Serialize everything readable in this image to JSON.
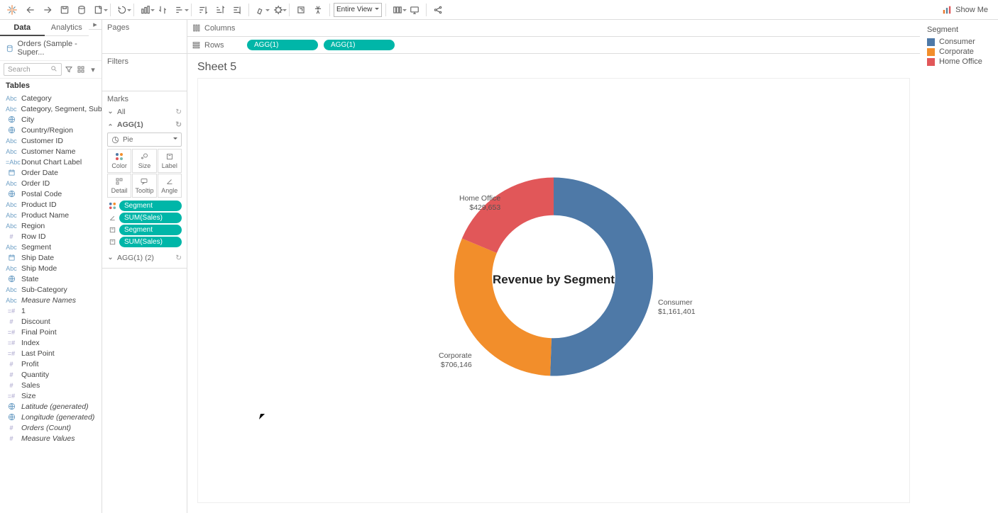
{
  "toolbar": {
    "fit_mode": "Entire View",
    "showme_label": "Show Me"
  },
  "side_tabs": {
    "data": "Data",
    "analytics": "Analytics"
  },
  "datasource": {
    "label": "Orders (Sample - Super..."
  },
  "search": {
    "placeholder": "Search"
  },
  "tables_header": "Tables",
  "fields": [
    {
      "t": "Abc",
      "n": "Category"
    },
    {
      "t": "Abc",
      "n": "Category, Segment, Sub-..."
    },
    {
      "t": "globe",
      "n": "City"
    },
    {
      "t": "globe",
      "n": "Country/Region"
    },
    {
      "t": "Abc",
      "n": "Customer ID"
    },
    {
      "t": "Abc",
      "n": "Customer Name"
    },
    {
      "t": "=Abc",
      "n": "Donut Chart Label"
    },
    {
      "t": "date",
      "n": "Order Date"
    },
    {
      "t": "Abc",
      "n": "Order ID"
    },
    {
      "t": "globe",
      "n": "Postal Code"
    },
    {
      "t": "Abc",
      "n": "Product ID"
    },
    {
      "t": "Abc",
      "n": "Product Name"
    },
    {
      "t": "Abc",
      "n": "Region"
    },
    {
      "t": "#",
      "n": "Row ID"
    },
    {
      "t": "Abc",
      "n": "Segment"
    },
    {
      "t": "date",
      "n": "Ship Date"
    },
    {
      "t": "Abc",
      "n": "Ship Mode"
    },
    {
      "t": "globe",
      "n": "State"
    },
    {
      "t": "Abc",
      "n": "Sub-Category"
    },
    {
      "t": "Abc",
      "n": "Measure Names",
      "i": true
    },
    {
      "t": "=#",
      "n": "1"
    },
    {
      "t": "#",
      "n": "Discount"
    },
    {
      "t": "=#",
      "n": "Final Point"
    },
    {
      "t": "=#",
      "n": "Index"
    },
    {
      "t": "=#",
      "n": "Last Point"
    },
    {
      "t": "#",
      "n": "Profit"
    },
    {
      "t": "#",
      "n": "Quantity"
    },
    {
      "t": "#",
      "n": "Sales"
    },
    {
      "t": "=#",
      "n": "Size"
    },
    {
      "t": "globe",
      "n": "Latitude (generated)",
      "i": true
    },
    {
      "t": "globe",
      "n": "Longitude (generated)",
      "i": true
    },
    {
      "t": "#",
      "n": "Orders (Count)",
      "i": true
    },
    {
      "t": "#",
      "n": "Measure Values",
      "i": true
    }
  ],
  "shelves": {
    "pages": "Pages",
    "filters": "Filters",
    "marks": "Marks",
    "all": "All",
    "agg1": "AGG(1)",
    "agg1_2": "AGG(1) (2)",
    "mark_type": "Pie",
    "cells": {
      "color": "Color",
      "size": "Size",
      "label": "Label",
      "detail": "Detail",
      "tooltip": "Tooltip",
      "angle": "Angle"
    },
    "pills": [
      {
        "icon": "color",
        "label": "Segment"
      },
      {
        "icon": "angle",
        "label": "SUM(Sales)"
      },
      {
        "icon": "label",
        "label": "Segment"
      },
      {
        "icon": "label",
        "label": "SUM(Sales)"
      }
    ]
  },
  "colrow": {
    "columns": "Columns",
    "rows": "Rows",
    "row_pills": [
      "AGG(1)",
      "AGG(1)"
    ]
  },
  "sheet": {
    "title": "Sheet 5",
    "center_text": "Revenue by Segment",
    "labels": {
      "home_office": {
        "name": "Home Office",
        "value": "$429,653"
      },
      "consumer": {
        "name": "Consumer",
        "value": "$1,161,401"
      },
      "corporate": {
        "name": "Corporate",
        "value": "$706,146"
      }
    }
  },
  "legend": {
    "title": "Segment",
    "items": [
      {
        "label": "Consumer",
        "color": "#4e79a7"
      },
      {
        "label": "Corporate",
        "color": "#f28e2b"
      },
      {
        "label": "Home Office",
        "color": "#e15759"
      }
    ]
  },
  "chart_data": {
    "type": "pie",
    "title": "Revenue by Segment",
    "series": [
      {
        "name": "Sales",
        "values": [
          1161401,
          706146,
          429653
        ]
      }
    ],
    "categories": [
      "Consumer",
      "Corporate",
      "Home Office"
    ],
    "colors": [
      "#4e79a7",
      "#f28e2b",
      "#e15759"
    ],
    "inner_radius": 0.62
  }
}
